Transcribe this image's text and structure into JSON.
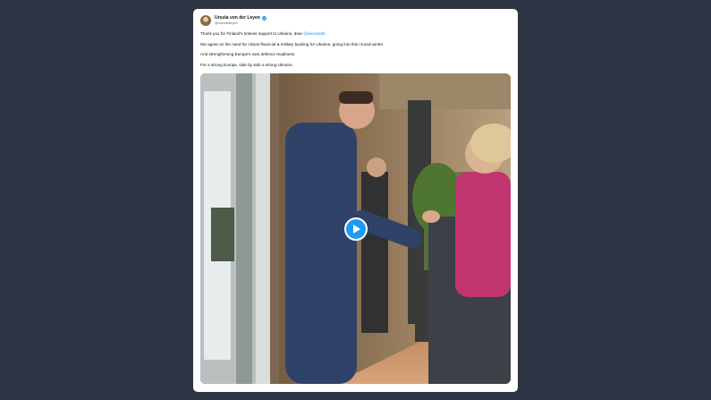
{
  "tweet": {
    "author": {
      "display_name": "Ursula von der Leyen",
      "handle": "@vonderleyen",
      "verified_icon": "verified-badge-icon"
    },
    "text": {
      "line1_before_mention": "Thank you for Finland's tireless support to Ukraine, dear ",
      "line1_mention": "@alexstubb",
      "line1_after_mention": ".",
      "line2": "We agree on the need for robust financial & military backing for Ukraine, going into this crucial winter.",
      "line3": "And strengthening Europe's own defence readiness.",
      "line4": "For a strong Europe, side by side a strong Ukraine."
    },
    "media": {
      "type": "video",
      "play_icon": "play-icon"
    }
  },
  "colors": {
    "page_background": "#2d3544",
    "card_background": "#ffffff",
    "link": "#1d9bf0",
    "play_button": "#1d9bf0"
  }
}
